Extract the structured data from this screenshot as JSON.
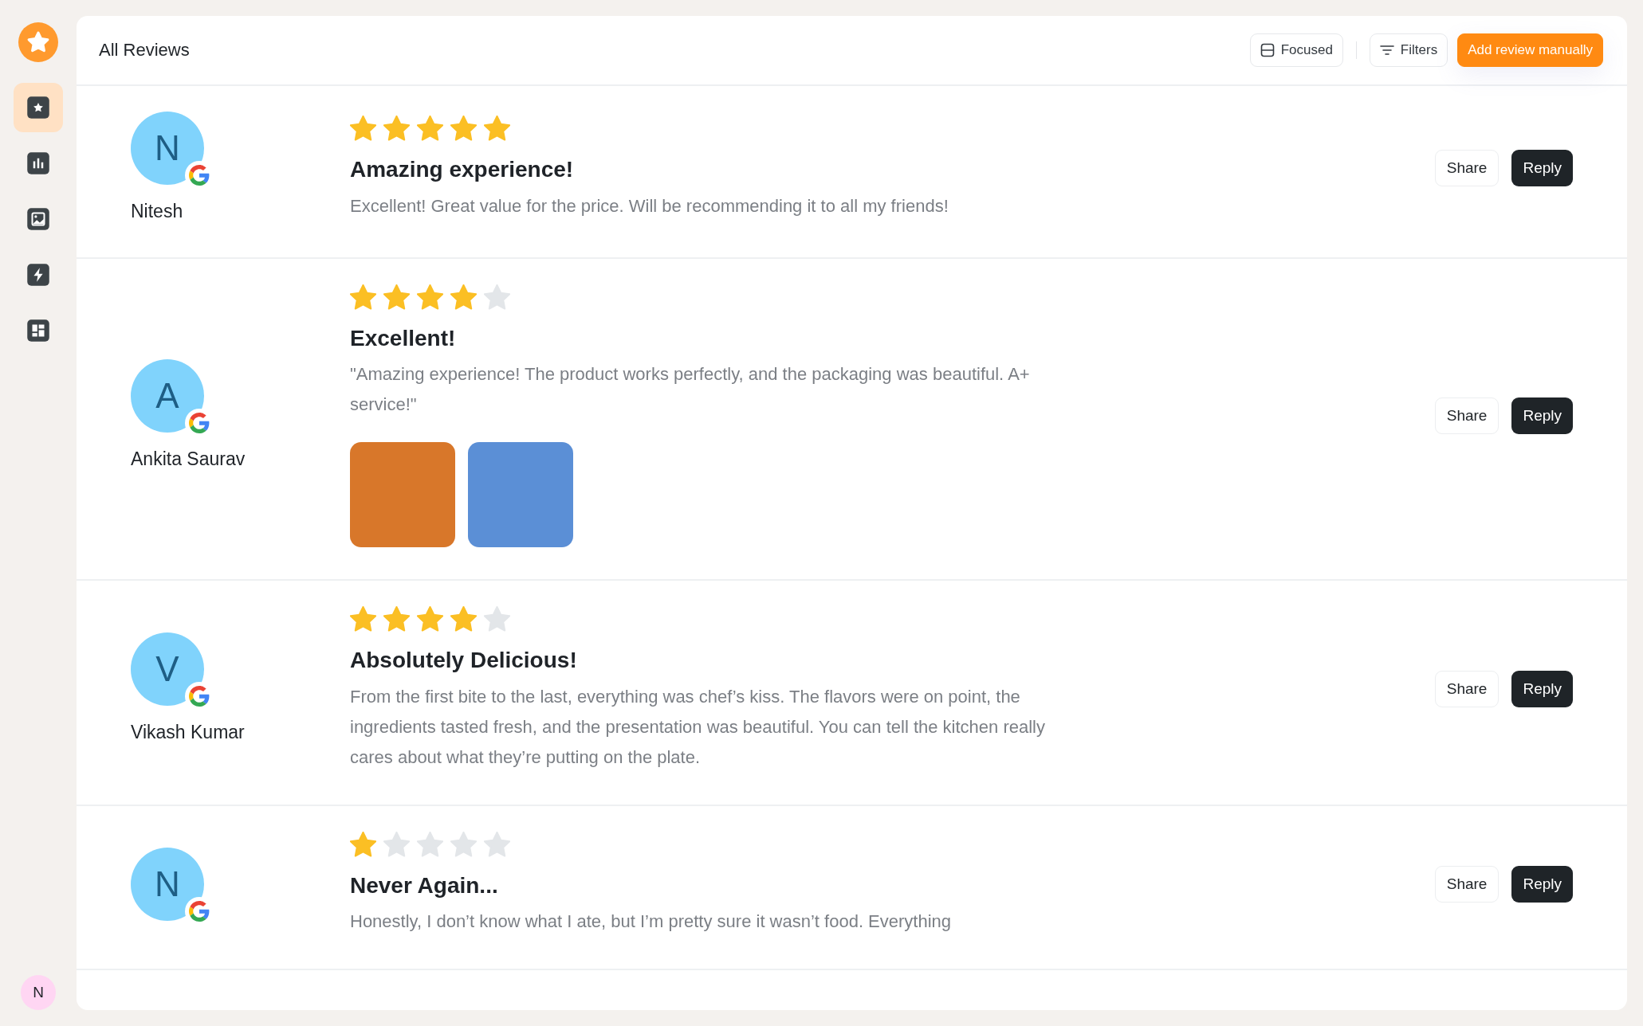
{
  "sidebar": {
    "items": [
      {
        "selected": true
      },
      {
        "selected": false
      },
      {
        "selected": false
      },
      {
        "selected": false
      },
      {
        "selected": false
      }
    ],
    "user_initial": "N"
  },
  "header": {
    "title": "All Reviews",
    "buttons": [
      {
        "label": "Focused",
        "kind": "view"
      },
      {
        "label": "Filters",
        "kind": "filter"
      },
      {
        "label": "Add review manually",
        "kind": "primary"
      }
    ]
  },
  "reviews": [
    {
      "initial": "N",
      "name": "Nitesh",
      "stars": 5,
      "title": "Amazing experience!",
      "text": "Excellent! Great value for the price. Will be recommending it to all my friends!",
      "actions": [
        "Share",
        "Reply"
      ]
    },
    {
      "initial": "A",
      "name": "Ankita Saurav",
      "stars": 4,
      "title": "Excellent!",
      "text": "\"Amazing experience! The product works perfectly, and the packaging was beautiful. A+ service!\"",
      "photos": [
        {
          "color": "#d8772a"
        },
        {
          "color": "#5b8fd6"
        }
      ],
      "actions": [
        "Share",
        "Reply"
      ]
    },
    {
      "initial": "V",
      "name": "Vikash Kumar",
      "stars": 4,
      "title": "Absolutely Delicious!",
      "text": "From the first bite to the last, everything was chef’s kiss. The flavors were on point, the ingredients tasted fresh, and the presentation was beautiful. You can tell the kitchen really cares about what they’re putting on the plate.",
      "actions": [
        "Share",
        "Reply"
      ]
    },
    {
      "initial": "N",
      "stars": 1,
      "title": "Never Again...",
      "text": "Honestly, I don’t know what I ate, but I’m pretty sure it wasn’t food. Everything",
      "actions": [
        "Share",
        "Reply"
      ]
    }
  ]
}
